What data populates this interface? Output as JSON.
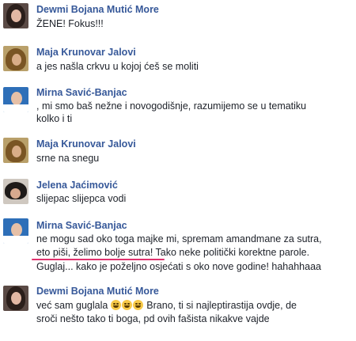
{
  "comments": [
    {
      "author": "Dewmi Bojana Mutić More",
      "lines": [
        "ŽENE! Fokus!!!"
      ]
    },
    {
      "author": "Maja Krunovar Jalovi",
      "lines": [
        "a jes našla crkvu u kojoj ćeš se moliti"
      ]
    },
    {
      "author": "Mirna Savić-Banjac",
      "lines": [
        ", mi smo baš nežne i novogodišnje, razumijemo se u tematiku",
        "kolko i ti"
      ]
    },
    {
      "author": "Maja Krunovar Jalovi",
      "lines": [
        "srne na snegu"
      ]
    },
    {
      "author": "Jelena Jaćimović",
      "lines": [
        "slijepac slijepca vodi"
      ]
    },
    {
      "author": "Mirna Savić-Banjac",
      "lines": [
        "ne mogu sad oko toga majke mi, spremam amandmane za sutra,",
        "eto piši, želimo bolje sutra! Tako neke politički korektne parole.",
        "Guglaj... kako je poželjno osjećati s oko nove godine! hahahhaaa"
      ]
    },
    {
      "author": "Dewmi Bojana Mutić More",
      "lines_pre": "već sam guglala ",
      "lines_post": " Brano, ti si najleptirastija ovdje, de",
      "lines": [
        "sroči nešto tako ti boga, pd ovih fašista nikakve vajde"
      ]
    }
  ],
  "colors": {
    "author": "#365899",
    "text": "#1d2129",
    "highlight": "#e0326e",
    "emoji": "#f7c948"
  },
  "icons": [
    "avatar",
    "laughing-emoji"
  ]
}
